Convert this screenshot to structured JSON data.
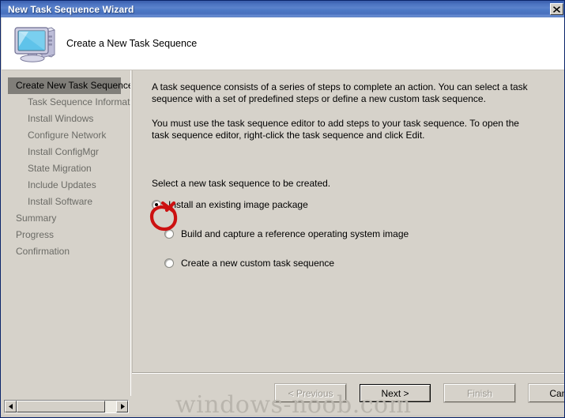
{
  "window": {
    "title": "New Task Sequence Wizard",
    "close_icon": "close-x-icon"
  },
  "header": {
    "icon": "computer-monitor-tower-icon",
    "title": "Create a New Task Sequence"
  },
  "sidebar": {
    "items": [
      {
        "label": "Create New Task Sequence",
        "selected": true,
        "indent": false
      },
      {
        "label": "Task Sequence Information",
        "selected": false,
        "indent": true
      },
      {
        "label": "Install Windows",
        "selected": false,
        "indent": true
      },
      {
        "label": "Configure Network",
        "selected": false,
        "indent": true
      },
      {
        "label": "Install ConfigMgr",
        "selected": false,
        "indent": true
      },
      {
        "label": "State Migration",
        "selected": false,
        "indent": true
      },
      {
        "label": "Include Updates",
        "selected": false,
        "indent": true
      },
      {
        "label": "Install Software",
        "selected": false,
        "indent": true
      },
      {
        "label": "Summary",
        "selected": false,
        "indent": false
      },
      {
        "label": "Progress",
        "selected": false,
        "indent": false
      },
      {
        "label": "Confirmation",
        "selected": false,
        "indent": false
      }
    ],
    "scrollbar": {
      "left_arrow_icon": "arrow-left-icon",
      "right_arrow_icon": "arrow-right-icon"
    }
  },
  "main": {
    "paragraph1": "A task sequence consists of a series of steps to complete an action. You can select a task sequence with a set of predefined steps or define a new custom task sequence.",
    "paragraph2": "You must use the task sequence editor to add steps to your task sequence. To open the task sequence editor, right-click the task sequence and click Edit.",
    "prompt": "Select a new task sequence to be created.",
    "options": [
      {
        "label": "Install an existing image package",
        "selected": true
      },
      {
        "label": "Build and capture a reference operating system image",
        "selected": false
      },
      {
        "label": "Create a new custom task sequence",
        "selected": false
      }
    ]
  },
  "annotation": {
    "type": "hand-drawn-red-circle",
    "color": "#cc1111",
    "targets": "install-an-existing-image-package-radio"
  },
  "footer": {
    "buttons": [
      {
        "label": "< Previous",
        "state": "disabled",
        "default": false
      },
      {
        "label": "Next >",
        "state": "enabled",
        "default": true
      },
      {
        "label": "Finish",
        "state": "disabled",
        "default": false
      },
      {
        "label": "Cancel",
        "state": "enabled",
        "default": false
      }
    ]
  },
  "watermark": {
    "text": "windows-noob.com"
  },
  "colors": {
    "titlebar_blue": "#4a72c0",
    "dialog_gray": "#d6d2ca",
    "selected_nav": "#807e79",
    "nav_text": "#6b6b66",
    "annotation_red": "#cc1111",
    "watermark_gray": "#b9b5ad"
  }
}
